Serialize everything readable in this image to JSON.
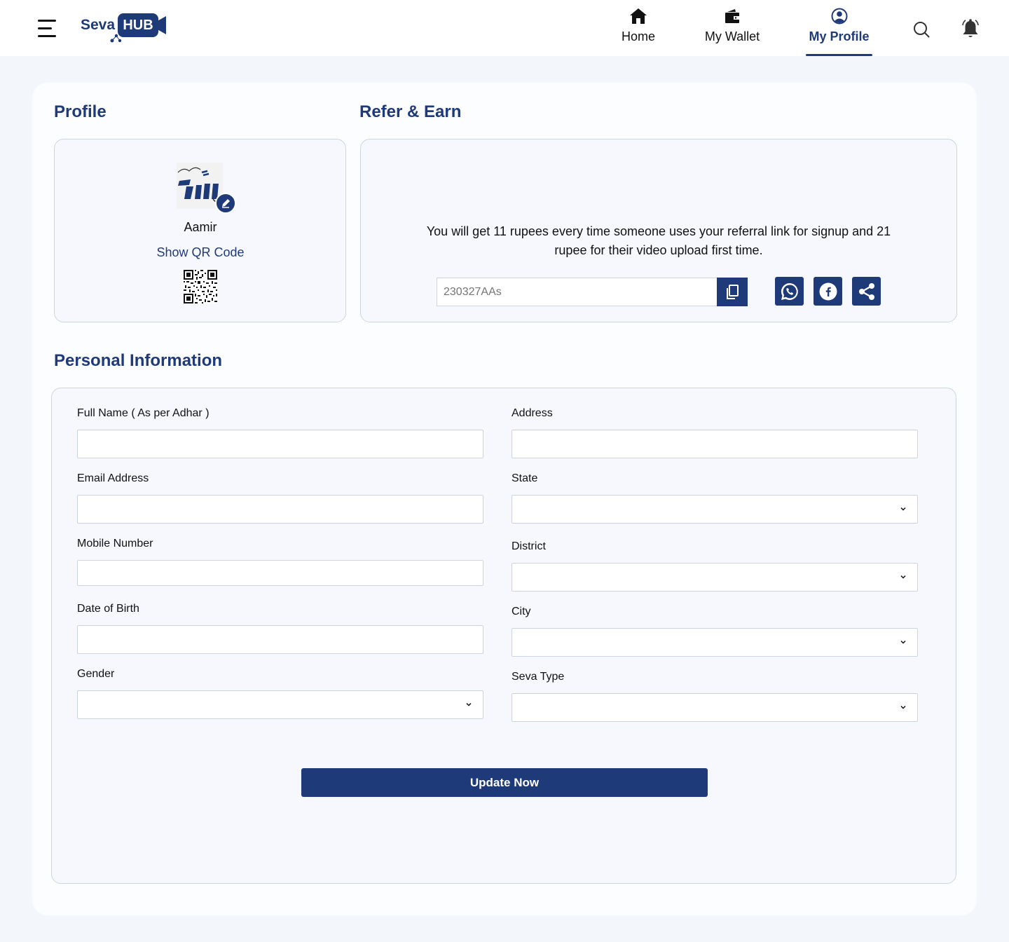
{
  "header": {
    "logo": {
      "seva": "Seva",
      "hub": "HUB"
    },
    "nav": [
      {
        "label": "Home",
        "icon": "home-icon",
        "active": false
      },
      {
        "label": "My Wallet",
        "icon": "wallet-icon",
        "active": false
      },
      {
        "label": "My Profile",
        "icon": "user-circle-icon",
        "active": true
      }
    ]
  },
  "profile": {
    "title": "Profile",
    "name": "Aamir",
    "qr_link": "Show QR Code"
  },
  "refer": {
    "title": "Refer & Earn",
    "description": "You will get 11 rupees every time someone uses your referral link for signup and 21 rupee for their video upload first time.",
    "code_placeholder": "230327AAs"
  },
  "personal": {
    "title": "Personal Information",
    "fields": {
      "full_name": {
        "label": "Full Name ( As per Adhar )",
        "value": ""
      },
      "email": {
        "label": "Email Address",
        "value": ""
      },
      "mobile": {
        "label": "Mobile Number",
        "value": ""
      },
      "dob": {
        "label": "Date of Birth",
        "value": ""
      },
      "gender": {
        "label": "Gender",
        "value": ""
      },
      "address": {
        "label": "Address",
        "value": ""
      },
      "state": {
        "label": "State",
        "value": ""
      },
      "district": {
        "label": "District",
        "value": ""
      },
      "city": {
        "label": "City",
        "value": ""
      },
      "seva_type": {
        "label": "Seva Type",
        "value": ""
      }
    },
    "submit_label": "Update Now"
  },
  "colors": {
    "brand": "#1f3a78",
    "page_bg": "#f3f6fb",
    "card_bg": "#fcfdff",
    "box_border": "#ccd4e3"
  }
}
